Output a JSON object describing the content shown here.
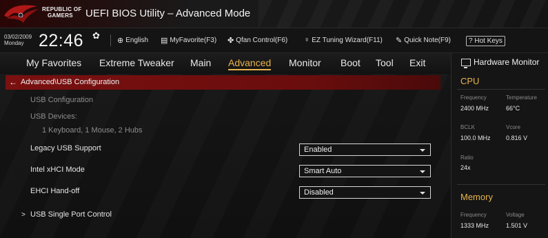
{
  "header": {
    "brand_line1": "REPUBLIC OF",
    "brand_line2": "GAMERS",
    "title": "UEFI BIOS Utility – Advanced Mode"
  },
  "infobar": {
    "date": "03/02/2009",
    "day": "Monday",
    "time": "22:46",
    "language": "English",
    "myfavorite": "MyFavorite(F3)",
    "qfan": "Qfan Control(F6)",
    "ez_tuning": "EZ Tuning Wizard(F11)",
    "quick_note": "Quick Note(F9)",
    "hot_keys": "Hot Keys"
  },
  "nav": {
    "tabs": [
      {
        "label": "My Favorites"
      },
      {
        "label": "Extreme Tweaker"
      },
      {
        "label": "Main"
      },
      {
        "label": "Advanced",
        "active": true
      },
      {
        "label": "Monitor"
      },
      {
        "label": "Boot"
      },
      {
        "label": "Tool"
      },
      {
        "label": "Exit"
      }
    ]
  },
  "main": {
    "breadcrumb": "Advanced\\USB Configuration",
    "usb_config_label": "USB Configuration",
    "usb_devices_label": "USB Devices:",
    "usb_devices_value": "1 Keyboard, 1 Mouse, 2 Hubs",
    "settings": [
      {
        "label": "Legacy USB Support",
        "value": "Enabled"
      },
      {
        "label": "Intel xHCI Mode",
        "value": "Smart Auto"
      },
      {
        "label": "EHCI Hand-off",
        "value": "Disabled"
      }
    ],
    "submenu": "USB Single Port Control"
  },
  "hardware_monitor": {
    "title": "Hardware Monitor",
    "cpu": {
      "section": "CPU",
      "frequency_label": "Frequency",
      "frequency": "2400 MHz",
      "temperature_label": "Temperature",
      "temperature": "66°C",
      "bclk_label": "BCLK",
      "bclk": "100.0 MHz",
      "vcore_label": "Vcore",
      "vcore": "0.816 V",
      "ratio_label": "Ratio",
      "ratio": "24x"
    },
    "memory": {
      "section": "Memory",
      "frequency_label": "Frequency",
      "frequency": "1333 MHz",
      "voltage_label": "Voltage",
      "voltage": "1.501 V"
    }
  },
  "colors": {
    "accent": "#e8b44c",
    "breadcrumb_bg": "#7a1010"
  }
}
